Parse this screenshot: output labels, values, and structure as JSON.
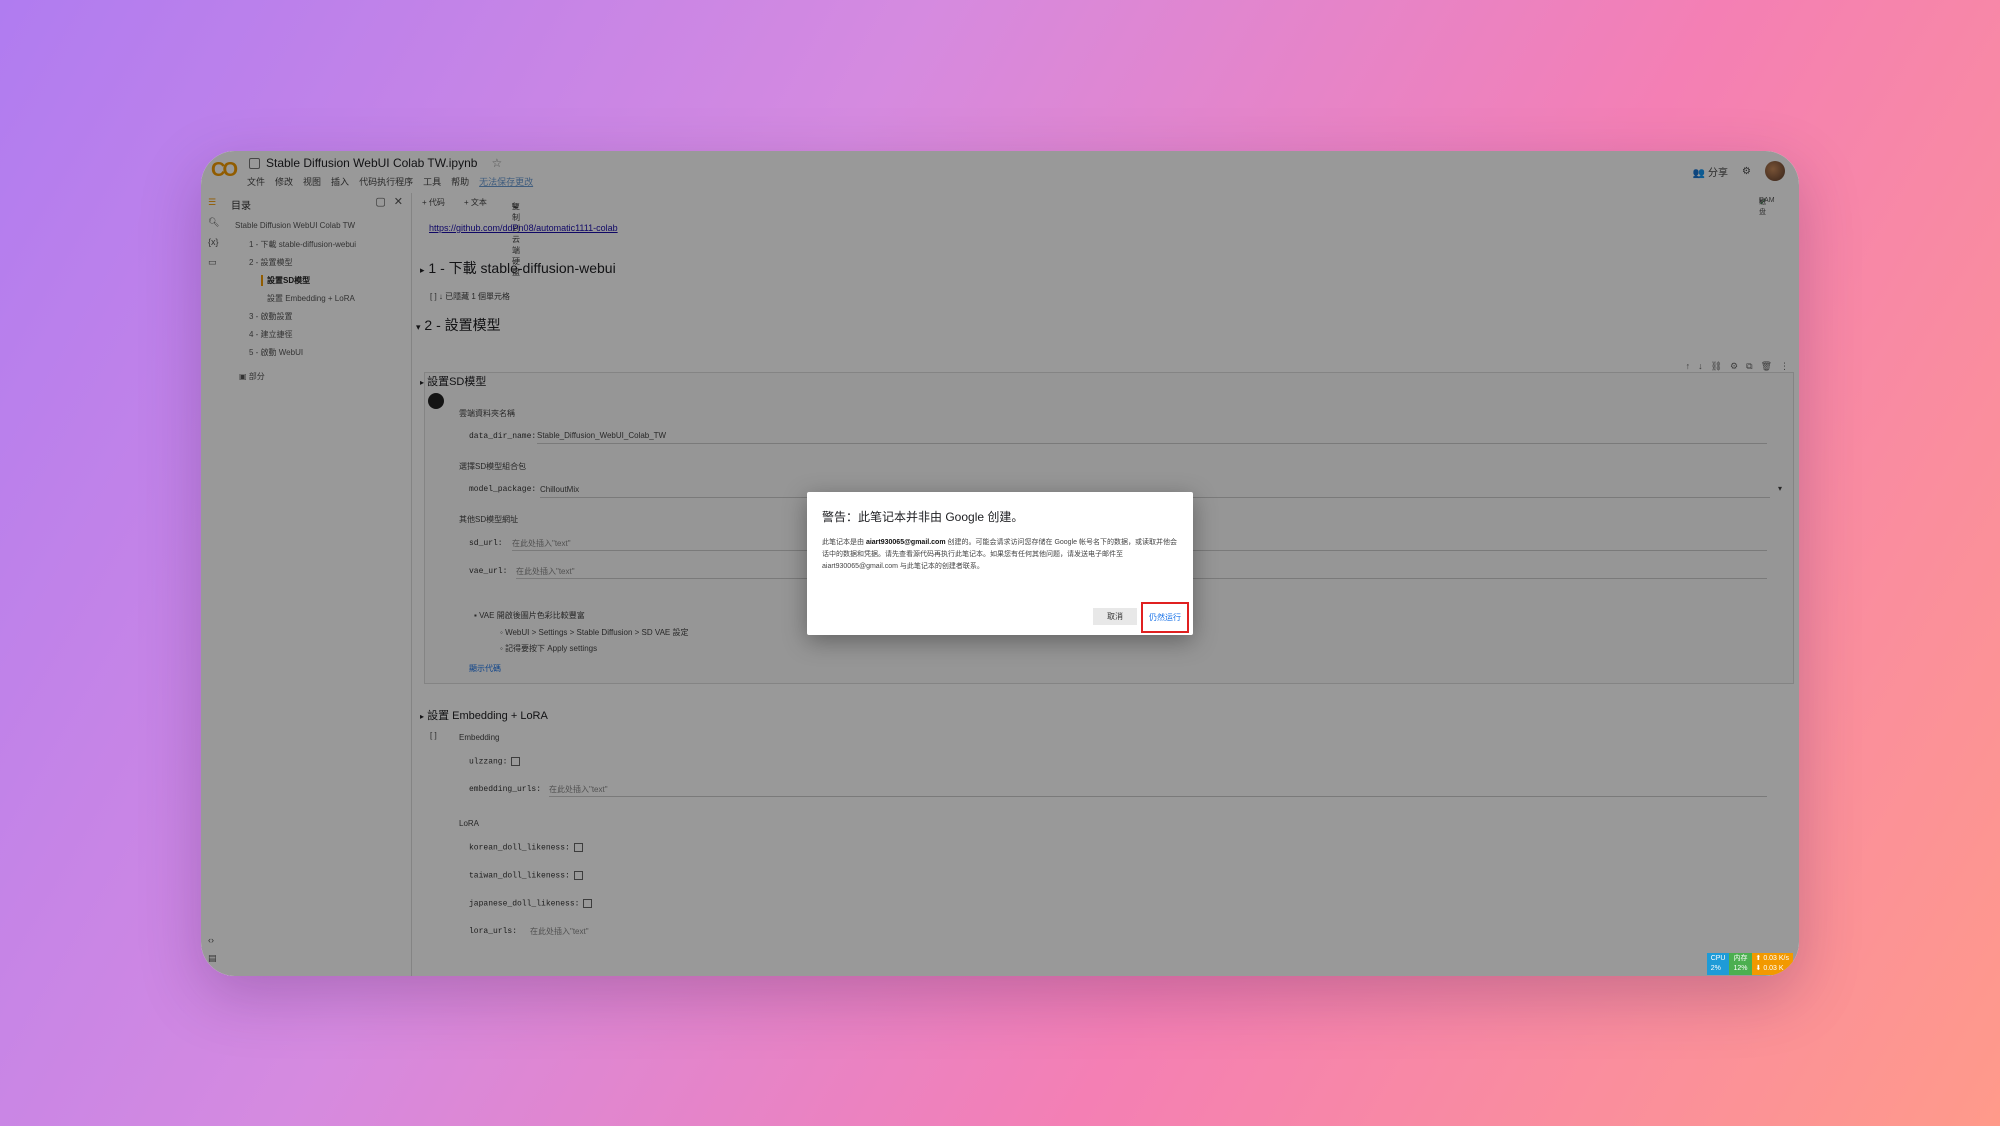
{
  "window": {
    "logo": "CO",
    "title": "Stable Diffusion WebUI Colab TW.ipynb",
    "menu": [
      "文件",
      "修改",
      "视图",
      "插入",
      "代码执行程序",
      "工具",
      "帮助"
    ],
    "saved_status": "无法保存更改",
    "share_label": "分享"
  },
  "toolbar": {
    "code_btn": "+ 代码",
    "text_btn": "+ 文本",
    "copy_drive": "复制到云端硬盘",
    "ram_label": "RAM",
    "disk_label": "磁盘"
  },
  "toc": {
    "header": "目录",
    "items": [
      {
        "label": "Stable Diffusion WebUI Colab TW"
      },
      {
        "label": "1 - 下載 stable-diffusion-webui"
      },
      {
        "label": "2 - 設置模型"
      },
      {
        "label": "設置SD模型"
      },
      {
        "label": "設置 Embedding + LoRA"
      },
      {
        "label": "3 - 啟動設置"
      },
      {
        "label": "4 - 建立捷徑"
      },
      {
        "label": "5 - 啟動 WebUI"
      }
    ],
    "section_btn": "部分"
  },
  "notebook": {
    "link": "https://github.com/ddPn08/automatic1111-colab",
    "sec1": "1 - 下載 stable-diffusion-webui",
    "hidden_cell": "↓ 已隱藏 1 個單元格",
    "sec2": "2 - 設置模型",
    "sub_sd": "設置SD模型",
    "data_dir_label": "雲端資料夾名稱",
    "data_dir_key": "data_dir_name:",
    "data_dir_val": "Stable_Diffusion_WebUI_Colab_TW",
    "model_pkg_label": "選擇SD模型組合包",
    "model_pkg_key": "model_package:",
    "model_pkg_val": "ChilloutMix",
    "other_label": "其他SD模型網址",
    "sd_url_key": "sd_url:",
    "sd_url_ph": "在此处插入\"text\"",
    "vae_url_key": "vae_url:",
    "vae_url_ph": "在此处插入\"text\"",
    "vae_note": "VAE 開啟後圖片色彩比較豐富",
    "vae_step1": "WebUI > Settings > Stable Diffusion > SD VAE 設定",
    "vae_step2": "記得要按下 Apply settings",
    "show_code": "顯示代碼",
    "sub_emb": "設置 Embedding + LoRA",
    "emb_label": "Embedding",
    "ulzzang_key": "ulzzang:",
    "emb_urls_key": "embedding_urls:",
    "emb_urls_ph": "在此处插入\"text\"",
    "lora_label": "LoRA",
    "korean_key": "korean_doll_likeness:",
    "taiwan_key": "taiwan_doll_likeness:",
    "japanese_key": "japanese_doll_likeness:",
    "lora_urls_key": "lora_urls:",
    "lora_urls_ph": "在此处插入\"text\"",
    "cell_idx": "[ ]"
  },
  "dialog": {
    "title": "警告：此笔记本并非由 Google 创建。",
    "body_pre": "此笔记本是由",
    "email": "aiart930065@gmail.com",
    "body_mid": "创建的。可能会请求访问您存储在 Google 帐号名下的数据，或读取并他会话中的数据和凭据。请先查看源代码再执行此笔记本。如果您有任何其他问题，请发送电子邮件至 aiart930065@gmail.com 与此笔记本的创建者联系。",
    "cancel": "取消",
    "run_anyway": "仍然运行"
  },
  "stats": {
    "cpu": "CPU",
    "cpu_val": "2%",
    "mem": "内存",
    "mem_val": "12%",
    "up": "0.03 K/s",
    "down": "0.03 K"
  },
  "colors": {
    "accent": "#f29900",
    "highlight": "#e02020",
    "link": "#1a0dab"
  }
}
